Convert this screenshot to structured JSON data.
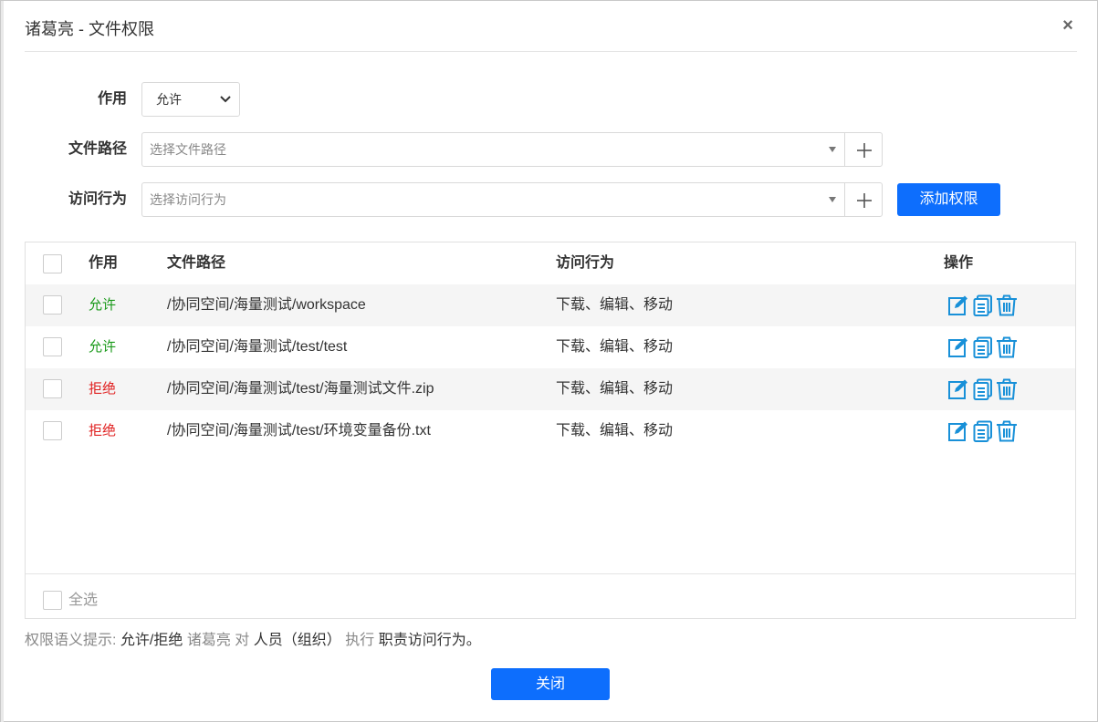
{
  "dialog": {
    "title": "诸葛亮 - 文件权限",
    "close_glyph": "×"
  },
  "form": {
    "effect_label": "作用",
    "effect_value": "允许",
    "path_label": "文件路径",
    "path_placeholder": "选择文件路径",
    "action_label": "访问行为",
    "action_placeholder": "选择访问行为",
    "add_button": "添加权限"
  },
  "table": {
    "headers": {
      "effect": "作用",
      "path": "文件路径",
      "action": "访问行为",
      "ops": "操作"
    },
    "rows": [
      {
        "effect": "允许",
        "effect_type": "allow",
        "path": "/协同空间/海量测试/workspace",
        "action": "下载、编辑、移动"
      },
      {
        "effect": "允许",
        "effect_type": "allow",
        "path": "/协同空间/海量测试/test/test",
        "action": "下载、编辑、移动"
      },
      {
        "effect": "拒绝",
        "effect_type": "deny",
        "path": "/协同空间/海量测试/test/海量测试文件.zip",
        "action": "下载、编辑、移动"
      },
      {
        "effect": "拒绝",
        "effect_type": "deny",
        "path": "/协同空间/海量测试/test/环境变量备份.txt",
        "action": "下载、编辑、移动"
      }
    ],
    "select_all": "全选"
  },
  "hint": {
    "prefix": "权限语义提示:",
    "effect": "允许/拒绝",
    "subject": "诸葛亮",
    "to": "对",
    "object": "人员（组织）",
    "exec": "执行",
    "action": "职责访问行为。"
  },
  "footer": {
    "close_button": "关闭"
  },
  "colors": {
    "primary": "#0d6efd",
    "allow": "#1a9a1a",
    "deny": "#e02020",
    "icon": "#1890d8",
    "row_alt": "#f5f5f5"
  },
  "icons": {
    "chevron": "chevron-down-icon",
    "dropdown": "caret-down-icon",
    "plus": "plus-icon",
    "edit": "edit-icon",
    "copy": "copy-icon",
    "delete": "trash-icon",
    "close": "close-icon"
  }
}
